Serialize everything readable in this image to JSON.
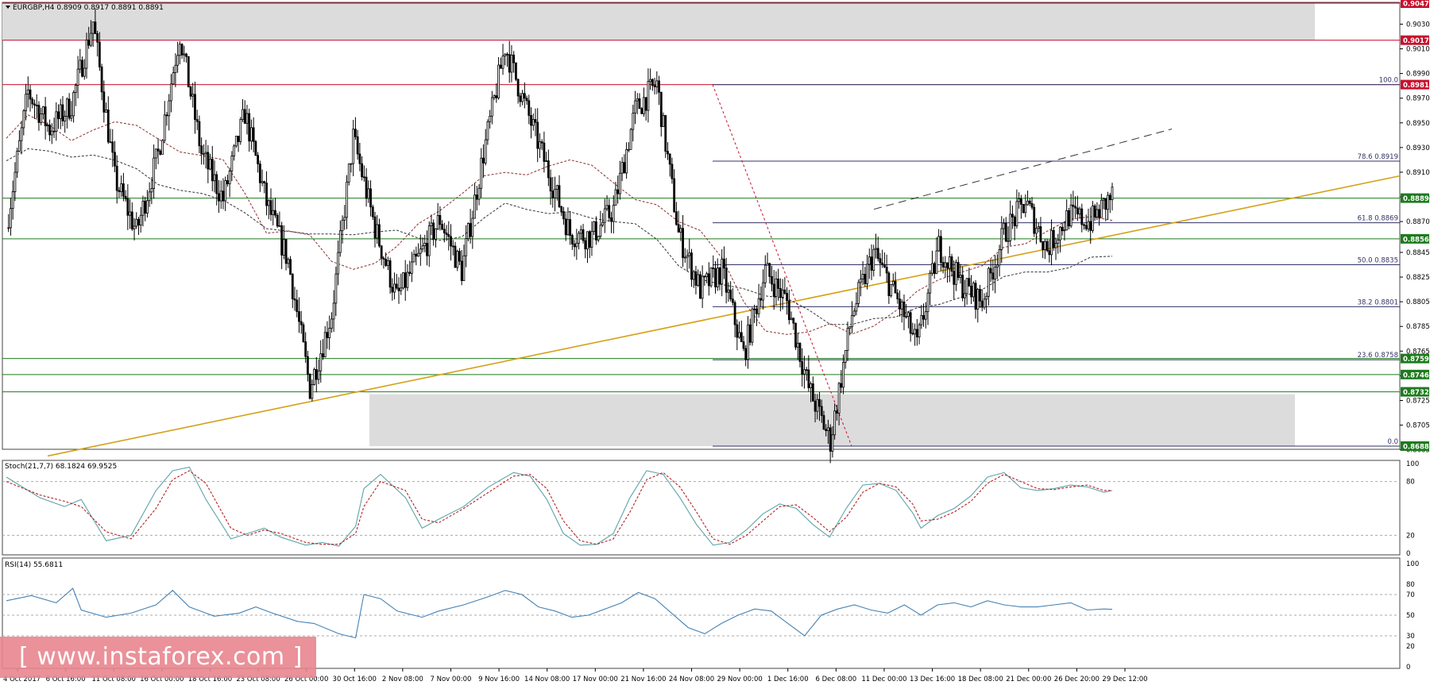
{
  "header": {
    "title": "EURGBP,H4  0.8909 0.8917 0.8891 0.8891"
  },
  "panels": {
    "stoch_label": "Stoch(21,7,7) 68.1824 69.9525",
    "rsi_label": "RSI(14) 55.6811"
  },
  "price_axis": {
    "ticks": [
      "0.9030",
      "0.9010",
      "0.8990",
      "0.8970",
      "0.8950",
      "0.8930",
      "0.8910",
      "0.8890",
      "0.8870",
      "0.8845",
      "0.8825",
      "0.8805",
      "0.8785",
      "0.8765",
      "0.8745",
      "0.8725",
      "0.8705",
      "0.8685"
    ],
    "badges": [
      {
        "price": 0.9047,
        "label": "0.9047",
        "color": "#c8102e"
      },
      {
        "price": 0.9017,
        "label": "0.9017",
        "color": "#c8102e"
      },
      {
        "price": 0.8981,
        "label": "0.8981",
        "color": "#c8102e"
      },
      {
        "price": 0.8889,
        "label": "0.8889",
        "color": "#1e7b1e"
      },
      {
        "price": 0.8856,
        "label": "0.8856",
        "color": "#1e7b1e"
      },
      {
        "price": 0.8759,
        "label": "0.8759",
        "color": "#1e7b1e"
      },
      {
        "price": 0.8746,
        "label": "0.8746",
        "color": "#1e7b1e"
      },
      {
        "price": 0.8732,
        "label": "0.8732",
        "color": "#1e7b1e"
      },
      {
        "price": 0.8688,
        "label": "0.8688",
        "color": "#1e7b1e"
      }
    ]
  },
  "fib": [
    {
      "price": 0.8981,
      "label": "100.0"
    },
    {
      "price": 0.8919,
      "label": "78.6 0.8919"
    },
    {
      "price": 0.8869,
      "label": "61.8 0.8869"
    },
    {
      "price": 0.8835,
      "label": "50.0 0.8835"
    },
    {
      "price": 0.8801,
      "label": "38.2 0.8801"
    },
    {
      "price": 0.8758,
      "label": "23.6 0.8758"
    },
    {
      "price": 0.8688,
      "label": "0.0"
    }
  ],
  "osc_axis": {
    "stoch_ticks": [
      "100",
      "80",
      "20",
      "0"
    ],
    "rsi_ticks": [
      "100",
      "80",
      "70",
      "50",
      "30",
      "20",
      "0"
    ]
  },
  "time_axis": [
    "4 Oct 2017",
    "6 Oct 16:00",
    "11 Oct 08:00",
    "16 Oct 00:00",
    "18 Oct 16:00",
    "23 Oct 08:00",
    "26 Oct 00:00",
    "30 Oct 16:00",
    "2 Nov 08:00",
    "7 Nov 00:00",
    "9 Nov 16:00",
    "14 Nov 08:00",
    "17 Nov 00:00",
    "21 Nov 16:00",
    "24 Nov 08:00",
    "29 Nov 00:00",
    "1 Dec 16:00",
    "6 Dec 08:00",
    "11 Dec 00:00",
    "13 Dec 16:00",
    "18 Dec 08:00",
    "21 Dec 00:00",
    "26 Dec 20:00",
    "29 Dec 12:00"
  ],
  "watermark": {
    "text": "[ www.instaforex.com ]"
  },
  "colors": {
    "candle": "#000000",
    "trendline": "#d4a017",
    "support": "#2e7d32",
    "resistance": "#c8102e",
    "fib_line": "#333366",
    "stoch_main": "#5fa3a8",
    "stoch_signal": "#b22222",
    "rsi": "#4682b4",
    "zone": "#dcdcdc"
  },
  "chart_data": {
    "type": "candlestick",
    "symbol": "EURGBP",
    "timeframe": "H4",
    "ylim": [
      0.868,
      0.9047
    ],
    "close_path": [
      {
        "x": "4 Oct 2017",
        "y": 0.8865
      },
      {
        "x": "6 Oct 16:00",
        "y": 0.8975
      },
      {
        "x": "8 Oct",
        "y": 0.8945
      },
      {
        "x": "10 Oct",
        "y": 0.8965
      },
      {
        "x": "11 Oct 08:00",
        "y": 0.9032
      },
      {
        "x": "12 Oct",
        "y": 0.8905
      },
      {
        "x": "16 Oct 00:00",
        "y": 0.8862
      },
      {
        "x": "17 Oct",
        "y": 0.8925
      },
      {
        "x": "18 Oct 16:00",
        "y": 0.9022
      },
      {
        "x": "20 Oct",
        "y": 0.8925
      },
      {
        "x": "23 Oct 08:00",
        "y": 0.8888
      },
      {
        "x": "24 Oct",
        "y": 0.8958
      },
      {
        "x": "26 Oct 00:00",
        "y": 0.8885
      },
      {
        "x": "27 Oct",
        "y": 0.8838
      },
      {
        "x": "30 Oct 16:00",
        "y": 0.8735
      },
      {
        "x": "1 Nov",
        "y": 0.8795
      },
      {
        "x": "2 Nov 08:00",
        "y": 0.8938
      },
      {
        "x": "3 Nov",
        "y": 0.8865
      },
      {
        "x": "7 Nov 00:00",
        "y": 0.8808
      },
      {
        "x": "8 Nov",
        "y": 0.884
      },
      {
        "x": "9 Nov 16:00",
        "y": 0.8872
      },
      {
        "x": "10 Nov",
        "y": 0.883
      },
      {
        "x": "13 Nov",
        "y": 0.8925
      },
      {
        "x": "14 Nov 08:00",
        "y": 0.9012
      },
      {
        "x": "15 Nov",
        "y": 0.896
      },
      {
        "x": "17 Nov 00:00",
        "y": 0.891
      },
      {
        "x": "20 Nov",
        "y": 0.886
      },
      {
        "x": "21 Nov 16:00",
        "y": 0.8858
      },
      {
        "x": "22 Nov",
        "y": 0.888
      },
      {
        "x": "24 Nov 08:00",
        "y": 0.896
      },
      {
        "x": "27 Nov",
        "y": 0.8982
      },
      {
        "x": "28 Nov",
        "y": 0.886
      },
      {
        "x": "29 Nov 00:00",
        "y": 0.8815
      },
      {
        "x": "30 Nov",
        "y": 0.883
      },
      {
        "x": "1 Dec 16:00",
        "y": 0.8762
      },
      {
        "x": "4 Dec",
        "y": 0.883
      },
      {
        "x": "5 Dec",
        "y": 0.8805
      },
      {
        "x": "6 Dec 08:00",
        "y": 0.8735
      },
      {
        "x": "7 Dec",
        "y": 0.8692
      },
      {
        "x": "8 Dec",
        "y": 0.8795
      },
      {
        "x": "11 Dec 00:00",
        "y": 0.8845
      },
      {
        "x": "12 Dec",
        "y": 0.881
      },
      {
        "x": "13 Dec 16:00",
        "y": 0.877
      },
      {
        "x": "14 Dec",
        "y": 0.885
      },
      {
        "x": "15 Dec",
        "y": 0.882
      },
      {
        "x": "18 Dec 08:00",
        "y": 0.8805
      },
      {
        "x": "19 Dec",
        "y": 0.886
      },
      {
        "x": "21 Dec 00:00",
        "y": 0.8886
      },
      {
        "x": "22 Dec",
        "y": 0.8848
      },
      {
        "x": "26 Dec 20:00",
        "y": 0.8875
      },
      {
        "x": "28 Dec",
        "y": 0.887
      },
      {
        "x": "29 Dec 12:00",
        "y": 0.8891
      }
    ],
    "stoch_main": [
      [
        0,
        85
      ],
      [
        4,
        62
      ],
      [
        7,
        52
      ],
      [
        9,
        60
      ],
      [
        12,
        14
      ],
      [
        15,
        20
      ],
      [
        18,
        70
      ],
      [
        20,
        92
      ],
      [
        22,
        96
      ],
      [
        24,
        60
      ],
      [
        27,
        16
      ],
      [
        29,
        22
      ],
      [
        31,
        28
      ],
      [
        33,
        18
      ],
      [
        36,
        9
      ],
      [
        38,
        12
      ],
      [
        40,
        8
      ],
      [
        42,
        30
      ],
      [
        43,
        72
      ],
      [
        45,
        88
      ],
      [
        48,
        62
      ],
      [
        50,
        28
      ],
      [
        52,
        38
      ],
      [
        55,
        52
      ],
      [
        58,
        74
      ],
      [
        61,
        90
      ],
      [
        63,
        86
      ],
      [
        65,
        60
      ],
      [
        67,
        22
      ],
      [
        69,
        9
      ],
      [
        71,
        10
      ],
      [
        73,
        22
      ],
      [
        75,
        62
      ],
      [
        77,
        92
      ],
      [
        79,
        88
      ],
      [
        81,
        62
      ],
      [
        83,
        32
      ],
      [
        85,
        9
      ],
      [
        87,
        12
      ],
      [
        89,
        26
      ],
      [
        91,
        44
      ],
      [
        93,
        55
      ],
      [
        95,
        50
      ],
      [
        97,
        32
      ],
      [
        99,
        18
      ],
      [
        101,
        50
      ],
      [
        103,
        76
      ],
      [
        105,
        78
      ],
      [
        107,
        70
      ],
      [
        109,
        45
      ],
      [
        110,
        28
      ],
      [
        112,
        42
      ],
      [
        114,
        50
      ],
      [
        116,
        64
      ],
      [
        118,
        85
      ],
      [
        120,
        90
      ],
      [
        122,
        73
      ],
      [
        124,
        70
      ],
      [
        126,
        72
      ],
      [
        128,
        76
      ],
      [
        130,
        74
      ],
      [
        132,
        68
      ],
      [
        133,
        70
      ]
    ],
    "stoch_signal": [
      [
        0,
        80
      ],
      [
        4,
        65
      ],
      [
        7,
        58
      ],
      [
        9,
        52
      ],
      [
        12,
        24
      ],
      [
        15,
        16
      ],
      [
        18,
        50
      ],
      [
        20,
        82
      ],
      [
        22,
        92
      ],
      [
        24,
        78
      ],
      [
        27,
        28
      ],
      [
        29,
        20
      ],
      [
        31,
        26
      ],
      [
        33,
        22
      ],
      [
        36,
        12
      ],
      [
        38,
        10
      ],
      [
        40,
        10
      ],
      [
        42,
        22
      ],
      [
        43,
        52
      ],
      [
        45,
        80
      ],
      [
        48,
        70
      ],
      [
        50,
        38
      ],
      [
        52,
        34
      ],
      [
        55,
        50
      ],
      [
        58,
        68
      ],
      [
        61,
        86
      ],
      [
        63,
        88
      ],
      [
        65,
        72
      ],
      [
        67,
        36
      ],
      [
        69,
        14
      ],
      [
        71,
        10
      ],
      [
        73,
        16
      ],
      [
        75,
        46
      ],
      [
        77,
        82
      ],
      [
        79,
        90
      ],
      [
        81,
        74
      ],
      [
        83,
        46
      ],
      [
        85,
        16
      ],
      [
        87,
        10
      ],
      [
        89,
        20
      ],
      [
        91,
        36
      ],
      [
        93,
        52
      ],
      [
        95,
        54
      ],
      [
        97,
        40
      ],
      [
        99,
        24
      ],
      [
        101,
        40
      ],
      [
        103,
        68
      ],
      [
        105,
        78
      ],
      [
        107,
        74
      ],
      [
        109,
        55
      ],
      [
        110,
        36
      ],
      [
        112,
        38
      ],
      [
        114,
        46
      ],
      [
        116,
        58
      ],
      [
        118,
        78
      ],
      [
        120,
        88
      ],
      [
        122,
        80
      ],
      [
        124,
        72
      ],
      [
        126,
        71
      ],
      [
        128,
        74
      ],
      [
        130,
        76
      ],
      [
        132,
        70
      ],
      [
        133,
        70
      ]
    ],
    "rsi": [
      [
        0,
        64
      ],
      [
        3,
        69
      ],
      [
        6,
        62
      ],
      [
        8,
        76
      ],
      [
        9,
        55
      ],
      [
        12,
        48
      ],
      [
        15,
        52
      ],
      [
        18,
        60
      ],
      [
        20,
        74
      ],
      [
        22,
        58
      ],
      [
        25,
        49
      ],
      [
        28,
        52
      ],
      [
        30,
        58
      ],
      [
        32,
        52
      ],
      [
        35,
        44
      ],
      [
        37,
        42
      ],
      [
        40,
        32
      ],
      [
        42,
        28
      ],
      [
        43,
        70
      ],
      [
        45,
        66
      ],
      [
        47,
        54
      ],
      [
        50,
        48
      ],
      [
        52,
        54
      ],
      [
        55,
        60
      ],
      [
        58,
        68
      ],
      [
        60,
        74
      ],
      [
        62,
        70
      ],
      [
        64,
        58
      ],
      [
        66,
        54
      ],
      [
        68,
        48
      ],
      [
        70,
        50
      ],
      [
        72,
        56
      ],
      [
        74,
        62
      ],
      [
        76,
        72
      ],
      [
        78,
        66
      ],
      [
        80,
        52
      ],
      [
        82,
        38
      ],
      [
        84,
        32
      ],
      [
        86,
        42
      ],
      [
        88,
        50
      ],
      [
        90,
        56
      ],
      [
        92,
        54
      ],
      [
        94,
        42
      ],
      [
        96,
        30
      ],
      [
        98,
        50
      ],
      [
        100,
        56
      ],
      [
        102,
        60
      ],
      [
        104,
        55
      ],
      [
        106,
        52
      ],
      [
        108,
        60
      ],
      [
        110,
        50
      ],
      [
        112,
        60
      ],
      [
        114,
        62
      ],
      [
        116,
        58
      ],
      [
        118,
        64
      ],
      [
        120,
        60
      ],
      [
        122,
        58
      ],
      [
        124,
        58
      ],
      [
        126,
        60
      ],
      [
        128,
        62
      ],
      [
        130,
        55
      ],
      [
        132,
        56
      ],
      [
        133,
        55.68
      ]
    ]
  }
}
